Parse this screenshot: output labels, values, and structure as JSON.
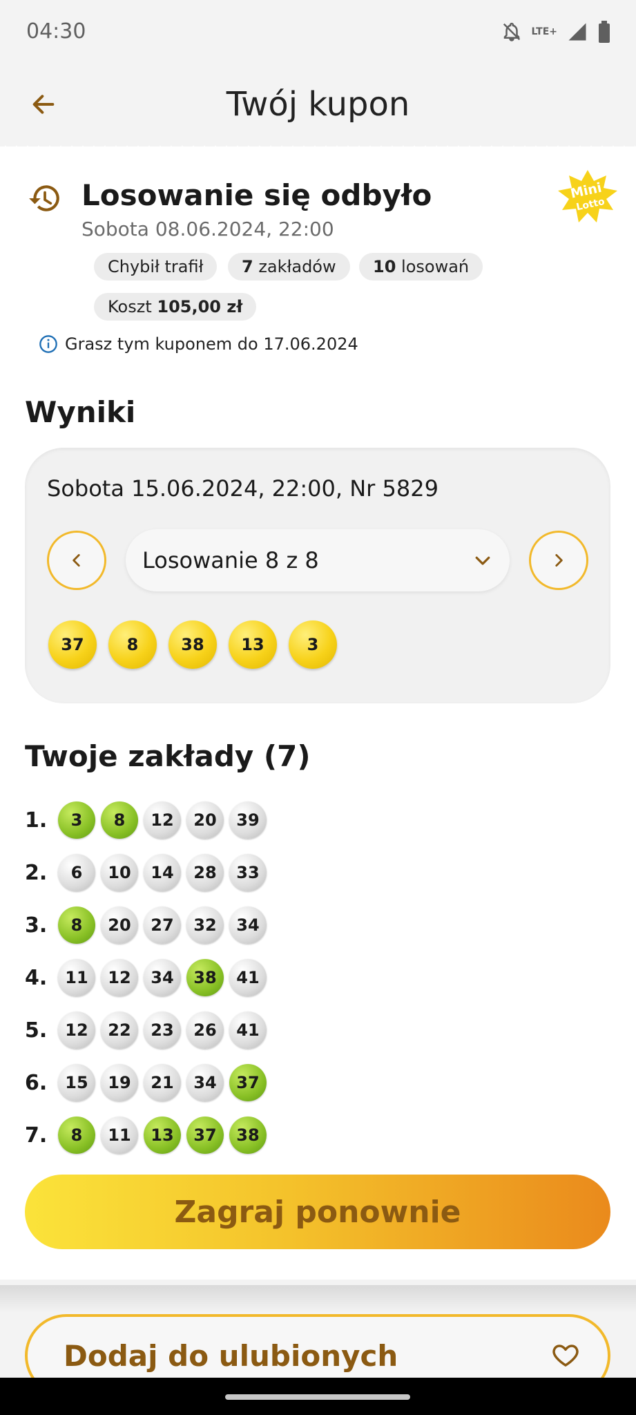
{
  "status": {
    "time": "04:30",
    "network": "LTE+"
  },
  "appbar": {
    "title": "Twój kupon"
  },
  "coupon": {
    "status_title": "Losowanie się odbyło",
    "draw_date": "Sobota 08.06.2024, 22:00",
    "logo_text_1": "Mini",
    "logo_text_2": "Lotto",
    "chips": {
      "missed": "Chybił trafił",
      "bets_count": "7",
      "bets_label": " zakładów",
      "draws_count": "10",
      "draws_label": " losowań",
      "cost_label": "Koszt ",
      "cost_value": "105,00 zł"
    },
    "info": "Grasz tym kuponem do 17.06.2024"
  },
  "results": {
    "heading": "Wyniki",
    "date_line": "Sobota 15.06.2024, 22:00, Nr 5829",
    "selector": "Losowanie 8 z 8",
    "numbers": [
      "37",
      "8",
      "38",
      "13",
      "3"
    ]
  },
  "bets": {
    "heading": "Twoje zakłady (7)",
    "rows": [
      {
        "label": "1.",
        "numbers": [
          {
            "n": "3",
            "hit": true
          },
          {
            "n": "8",
            "hit": true
          },
          {
            "n": "12",
            "hit": false
          },
          {
            "n": "20",
            "hit": false
          },
          {
            "n": "39",
            "hit": false
          }
        ]
      },
      {
        "label": "2.",
        "numbers": [
          {
            "n": "6",
            "hit": false
          },
          {
            "n": "10",
            "hit": false
          },
          {
            "n": "14",
            "hit": false
          },
          {
            "n": "28",
            "hit": false
          },
          {
            "n": "33",
            "hit": false
          }
        ]
      },
      {
        "label": "3.",
        "numbers": [
          {
            "n": "8",
            "hit": true
          },
          {
            "n": "20",
            "hit": false
          },
          {
            "n": "27",
            "hit": false
          },
          {
            "n": "32",
            "hit": false
          },
          {
            "n": "34",
            "hit": false
          }
        ]
      },
      {
        "label": "4.",
        "numbers": [
          {
            "n": "11",
            "hit": false
          },
          {
            "n": "12",
            "hit": false
          },
          {
            "n": "34",
            "hit": false
          },
          {
            "n": "38",
            "hit": true
          },
          {
            "n": "41",
            "hit": false
          }
        ]
      },
      {
        "label": "5.",
        "numbers": [
          {
            "n": "12",
            "hit": false
          },
          {
            "n": "22",
            "hit": false
          },
          {
            "n": "23",
            "hit": false
          },
          {
            "n": "26",
            "hit": false
          },
          {
            "n": "41",
            "hit": false
          }
        ]
      },
      {
        "label": "6.",
        "numbers": [
          {
            "n": "15",
            "hit": false
          },
          {
            "n": "19",
            "hit": false
          },
          {
            "n": "21",
            "hit": false
          },
          {
            "n": "34",
            "hit": false
          },
          {
            "n": "37",
            "hit": true
          }
        ]
      },
      {
        "label": "7.",
        "numbers": [
          {
            "n": "8",
            "hit": true
          },
          {
            "n": "11",
            "hit": false
          },
          {
            "n": "13",
            "hit": true
          },
          {
            "n": "37",
            "hit": true
          },
          {
            "n": "38",
            "hit": true
          }
        ]
      }
    ]
  },
  "actions": {
    "play_again": "Zagraj ponownie",
    "add_favorite": "Dodaj do ulubionych"
  },
  "colors": {
    "accent": "#f2b92b",
    "brand_text": "#8b5a12",
    "hit": "#88c025",
    "result_ball": "#f7d21a"
  }
}
